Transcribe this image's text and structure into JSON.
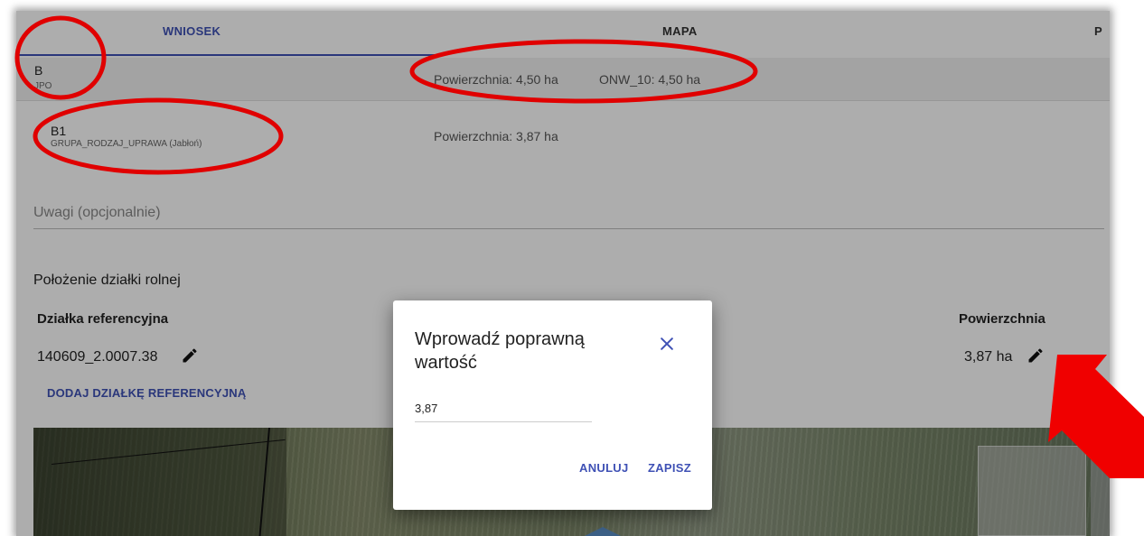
{
  "tabs": [
    {
      "label": "WNIOSEK",
      "active": true
    },
    {
      "label": "MAPA",
      "active": false
    },
    {
      "label": "P",
      "active": false
    }
  ],
  "parcel_group": {
    "code": "B",
    "subtitle": "JPO",
    "area_text": "Powierzchnia: 4,50 ha",
    "onw_text": "ONW_10: 4,50 ha"
  },
  "sub_parcel": {
    "code": "B1",
    "subtitle": "GRUPA_RODZAJ_UPRAWA (Jabłoń)",
    "area_text": "Powierzchnia: 3,87 ha"
  },
  "notes_placeholder": "Uwagi (opcjonalnie)",
  "location": {
    "section_title": "Położenie działki rolnej",
    "col_reference": "Działka referencyjna",
    "col_area": "Powierzchnia",
    "reference_value": "140609_2.0007.38",
    "area_value": "3,87 ha",
    "add_reference_label": "DODAJ DZIAŁKĘ REFERENCYJNĄ"
  },
  "dialog": {
    "title": "Wprowadź poprawną wartość",
    "input_value": "3,87",
    "cancel_label": "ANULUJ",
    "save_label": "ZAPISZ"
  },
  "colors": {
    "accent": "#3f51b5",
    "annotation": "#e00000"
  },
  "icons": {
    "edit": "pencil-icon",
    "close": "close-icon"
  }
}
